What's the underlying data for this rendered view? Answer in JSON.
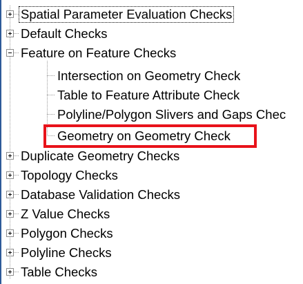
{
  "tree": {
    "nodes": [
      {
        "label": "Spatial Parameter Evaluation Checks",
        "expanded": false,
        "selected": true
      },
      {
        "label": "Default Checks",
        "expanded": false
      },
      {
        "label": "Feature on Feature Checks",
        "expanded": true
      },
      {
        "label": "Intersection on Geometry Check"
      },
      {
        "label": "Table to Feature Attribute Check"
      },
      {
        "label": "Polyline/Polygon Slivers and Gaps Chec"
      },
      {
        "label": "Geometry on Geometry Check"
      },
      {
        "label": "Duplicate Geometry Checks",
        "expanded": false
      },
      {
        "label": "Topology Checks",
        "expanded": false
      },
      {
        "label": "Database Validation Checks",
        "expanded": false
      },
      {
        "label": "Z Value Checks",
        "expanded": false
      },
      {
        "label": "Polygon Checks",
        "expanded": false
      },
      {
        "label": "Polyline Checks",
        "expanded": false
      },
      {
        "label": "Table Checks",
        "expanded": false
      }
    ]
  },
  "colors": {
    "highlight": "#e8121a",
    "window_border": "#2e5a99"
  }
}
